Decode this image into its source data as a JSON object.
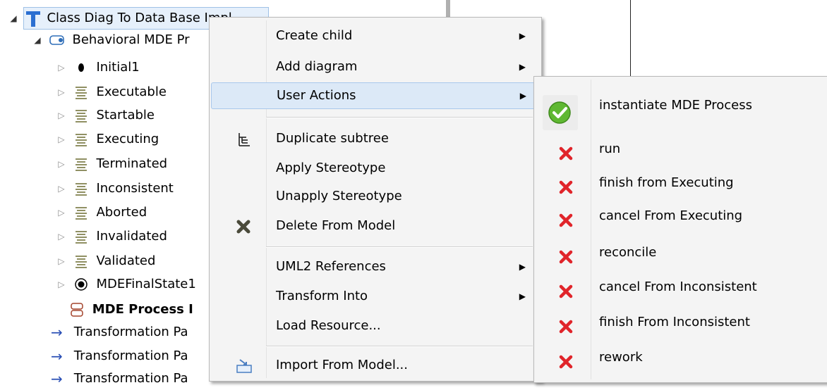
{
  "tree": {
    "root": "Class Diag To Data Base Impl",
    "process": "Behavioral MDE Pr",
    "states": [
      {
        "label": "Initial1",
        "icon": "initial-state-icon"
      },
      {
        "label": "Executable",
        "icon": "state-icon"
      },
      {
        "label": "Startable",
        "icon": "state-icon"
      },
      {
        "label": "Executing",
        "icon": "state-icon"
      },
      {
        "label": "Terminated",
        "icon": "state-icon"
      },
      {
        "label": "Inconsistent",
        "icon": "state-icon"
      },
      {
        "label": "Aborted",
        "icon": "state-icon"
      },
      {
        "label": "Invalidated",
        "icon": "state-icon"
      },
      {
        "label": "Validated",
        "icon": "state-icon"
      },
      {
        "label": "MDEFinalState1",
        "icon": "final-state-icon"
      }
    ],
    "process_item": "MDE Process I",
    "transformations": [
      "Transformation Pa",
      "Transformation Pa",
      "Transformation Pa"
    ]
  },
  "context_menu": {
    "items": [
      {
        "label": "Create child",
        "submenu": true
      },
      {
        "label": "Add diagram",
        "submenu": true
      },
      {
        "label": "User Actions",
        "submenu": true,
        "highlighted": true
      },
      {
        "label": "Duplicate subtree",
        "icon": "duplicate-icon"
      },
      {
        "label": "Apply Stereotype"
      },
      {
        "label": "Unapply Stereotype"
      },
      {
        "label": "Delete From Model",
        "icon": "delete-icon"
      },
      {
        "label": "UML2 References",
        "submenu": true
      },
      {
        "label": "Transform Into",
        "submenu": true
      },
      {
        "label": "Load Resource..."
      },
      {
        "label": "Import From Model...",
        "icon": "import-icon"
      }
    ]
  },
  "user_actions": {
    "items": [
      {
        "label": "instantiate MDE Process",
        "enabled": true,
        "icon": "check-icon"
      },
      {
        "label": "run",
        "enabled": false,
        "icon": "red-x-icon"
      },
      {
        "label": "finish from Executing",
        "enabled": false,
        "icon": "red-x-icon"
      },
      {
        "label": "cancel From Executing",
        "enabled": false,
        "icon": "red-x-icon"
      },
      {
        "label": "reconcile",
        "enabled": false,
        "icon": "red-x-icon"
      },
      {
        "label": "cancel From Inconsistent",
        "enabled": false,
        "icon": "red-x-icon"
      },
      {
        "label": "finish From Inconsistent",
        "enabled": false,
        "icon": "red-x-icon"
      },
      {
        "label": "rework",
        "enabled": false,
        "icon": "red-x-icon"
      }
    ]
  },
  "colors": {
    "check_green": "#5fb832",
    "x_red": "#e0242a",
    "highlight": "#dce9f7",
    "arrow_blue": "#2a4fb5"
  }
}
